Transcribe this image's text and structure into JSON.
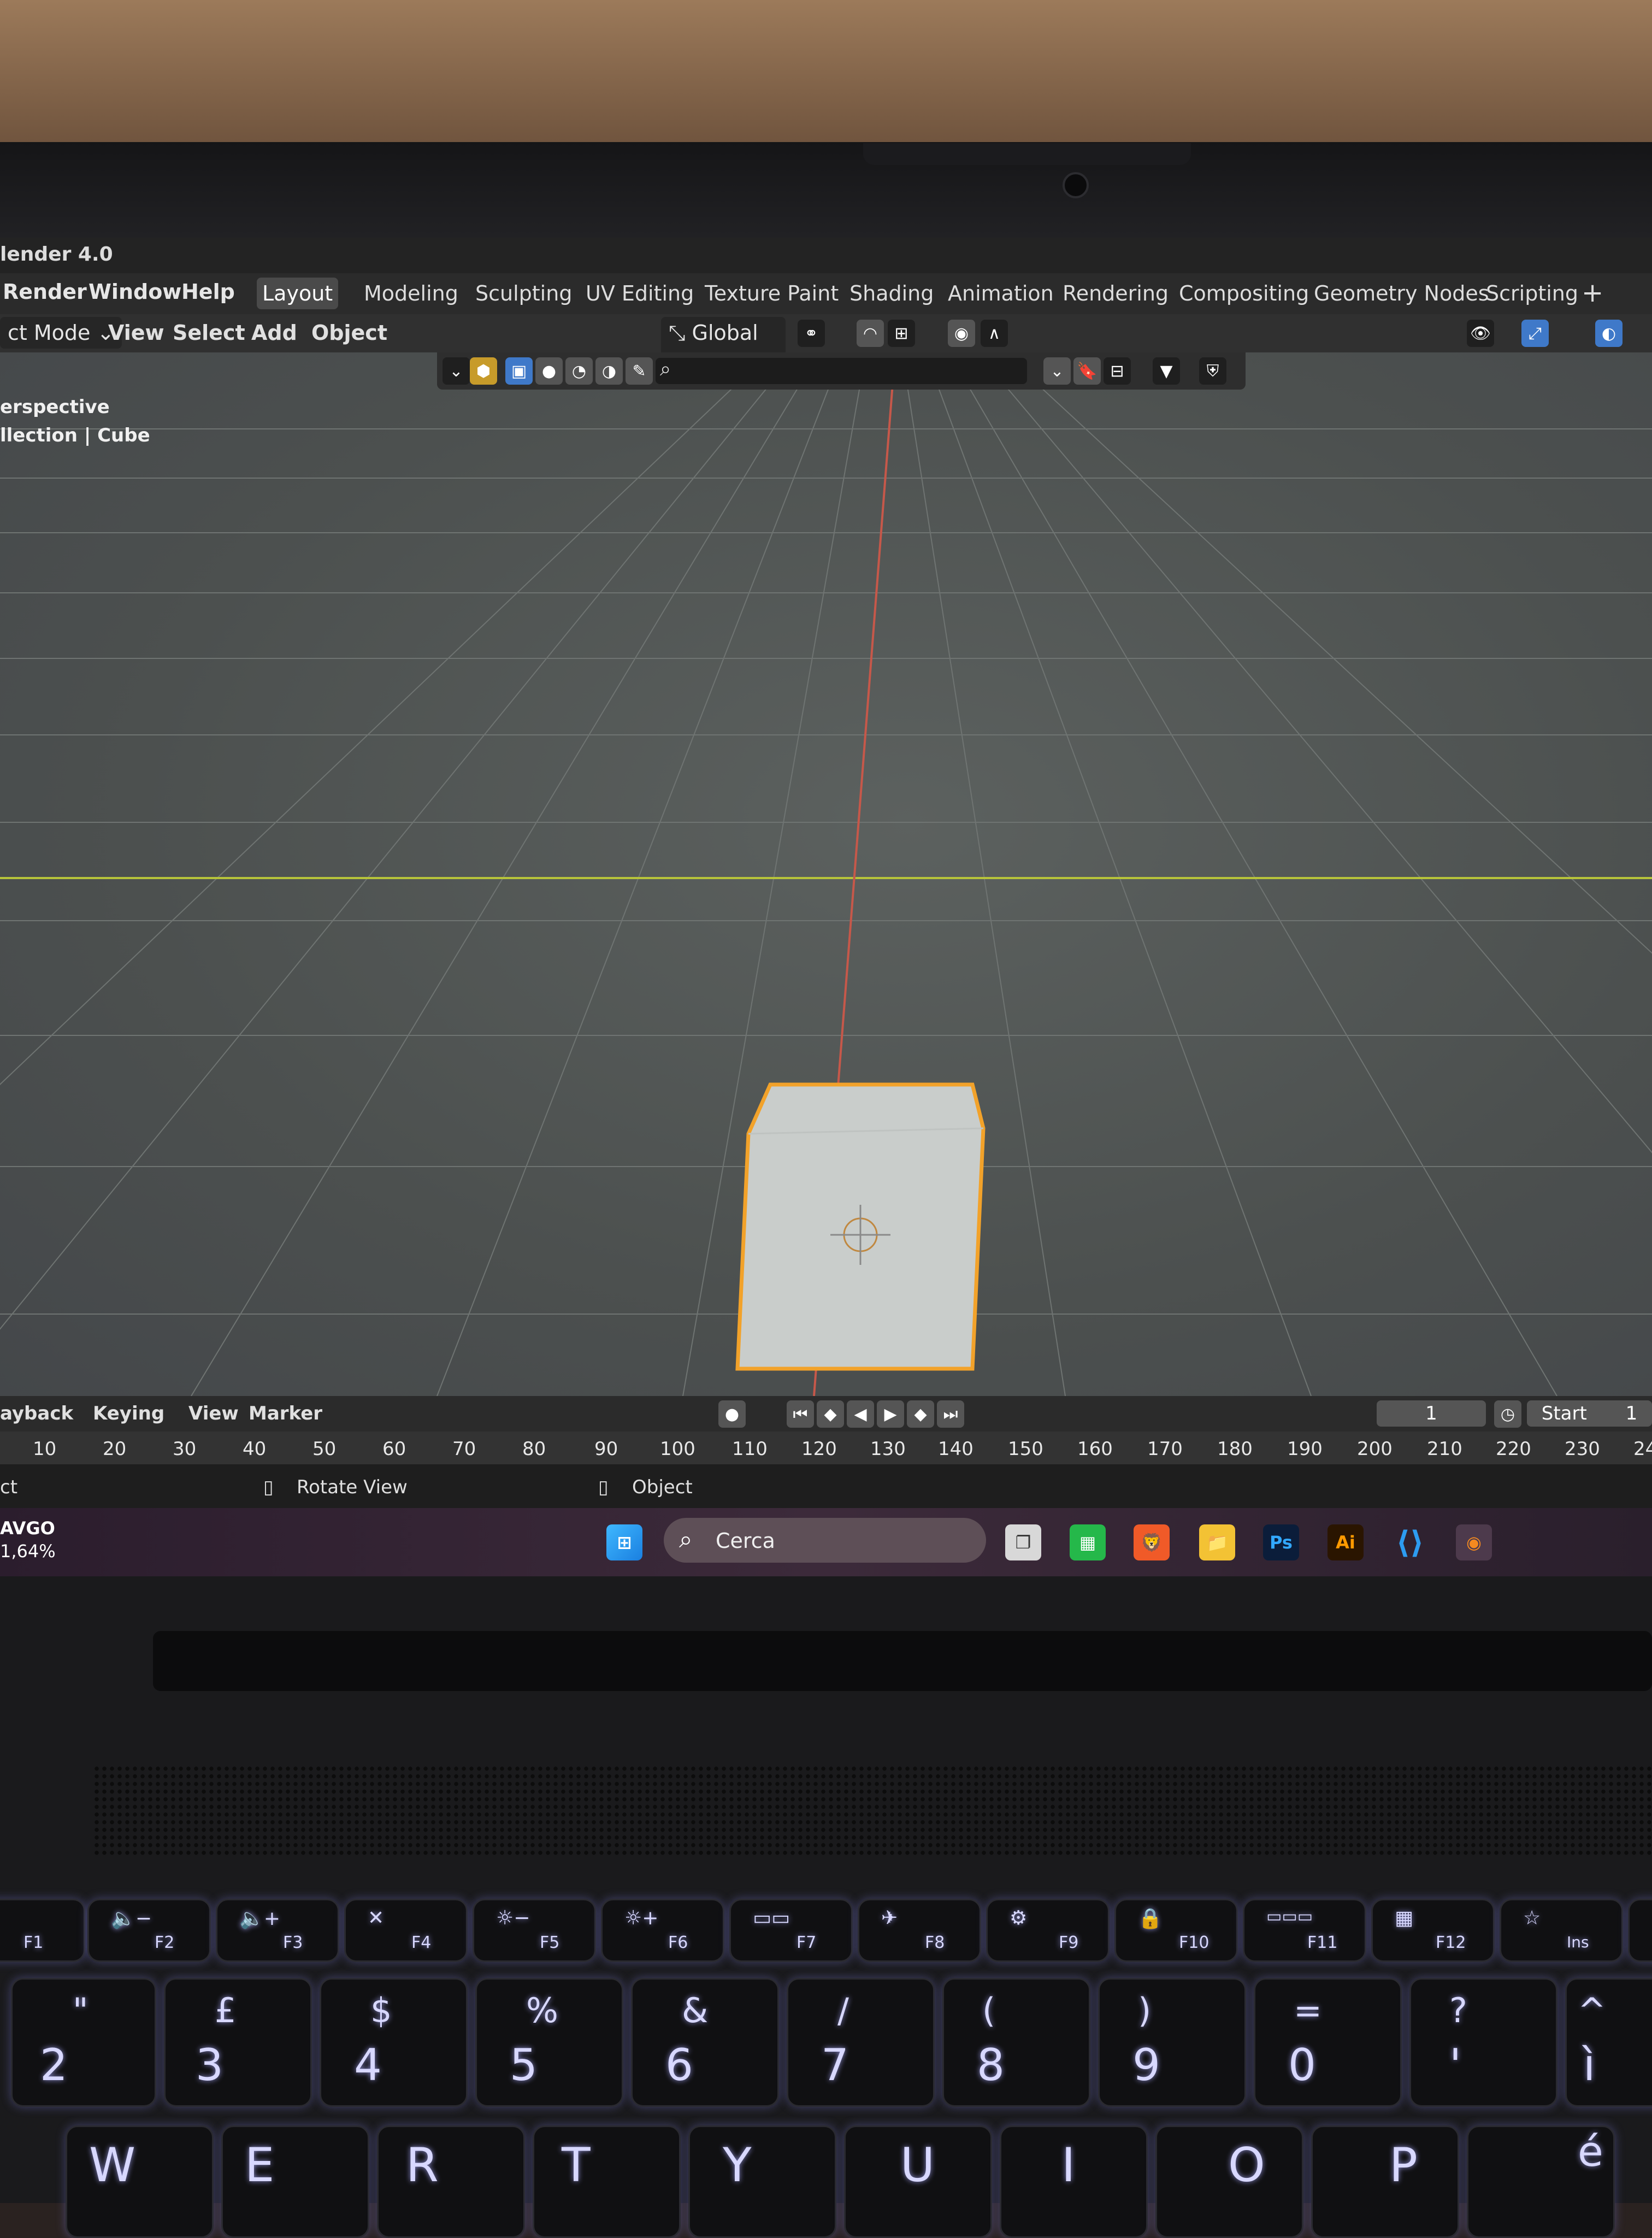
{
  "app": {
    "title": "lender 4.0",
    "menus": [
      "Render",
      "Window",
      "Help"
    ],
    "workspace_tabs": [
      "Layout",
      "Modeling",
      "Sculpting",
      "UV Editing",
      "Texture Paint",
      "Shading",
      "Animation",
      "Rendering",
      "Compositing",
      "Geometry Nodes",
      "Scripting"
    ],
    "active_tab": "Layout",
    "add_tab": "+"
  },
  "header": {
    "mode": "ct Mode",
    "menus": [
      "View",
      "Select",
      "Add",
      "Object"
    ],
    "transform_orientation": "Global"
  },
  "viewport": {
    "view_name": "erspective",
    "collection": "llection",
    "object": "Cube",
    "accent_color": "#f2a22a"
  },
  "timeline": {
    "menus": [
      "ayback",
      "Keying",
      "View",
      "Marker"
    ],
    "current_frame": "1",
    "start_label": "Start",
    "start_value": "1",
    "ruler_ticks": [
      "10",
      "20",
      "30",
      "40",
      "50",
      "60",
      "70",
      "80",
      "90",
      "100",
      "110",
      "120",
      "130",
      "140",
      "150",
      "160",
      "170",
      "180",
      "190",
      "200",
      "210",
      "220",
      "230",
      "24"
    ]
  },
  "statusbar": {
    "left": "ct",
    "rotate_view": "Rotate View",
    "object": "Object"
  },
  "taskbar": {
    "widget_line1": "AVGO",
    "widget_line2": "1,64%",
    "search_placeholder": "Cerca",
    "ps_label": "Ps",
    "ai_label": "Ai"
  },
  "keyboard": {
    "fn_row": [
      "F1",
      "F2",
      "F3",
      "F4",
      "F5",
      "F6",
      "F7",
      "F8",
      "F9",
      "F10",
      "F11",
      "F12",
      "Ins"
    ],
    "number_row": [
      {
        "top": "\"",
        "bottom": "2"
      },
      {
        "top": "£",
        "bottom": "3"
      },
      {
        "top": "$",
        "bottom": "4"
      },
      {
        "top": "%",
        "bottom": "5"
      },
      {
        "top": "&",
        "bottom": "6"
      },
      {
        "top": "/",
        "bottom": "7"
      },
      {
        "top": "(",
        "bottom": "8"
      },
      {
        "top": ")",
        "bottom": "9"
      },
      {
        "top": "=",
        "bottom": "0"
      },
      {
        "top": "?",
        "bottom": "'"
      },
      {
        "top": "^",
        "bottom": "ì"
      }
    ],
    "letter_row": [
      "W",
      "E",
      "R",
      "T",
      "Y",
      "U",
      "I",
      "O",
      "P",
      "é"
    ]
  }
}
